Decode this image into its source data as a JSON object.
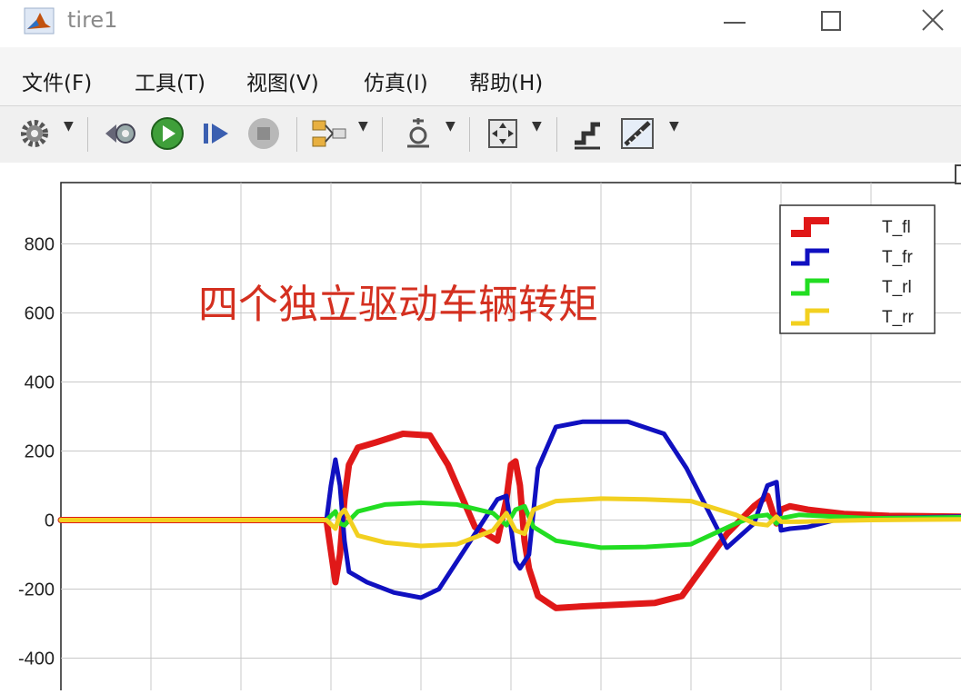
{
  "window": {
    "title": "tire1"
  },
  "menu": {
    "items": [
      "文件(F)",
      "工具(T)",
      "视图(V)",
      "仿真(I)",
      "帮助(H)"
    ]
  },
  "toolbar": {
    "icons": [
      "gear-icon",
      "signal-tap-icon",
      "run-icon",
      "step-forward-icon",
      "stop-icon",
      "signal-select-icon",
      "zoom-icon",
      "fit-view-icon",
      "style-icon",
      "ruler-icon"
    ]
  },
  "chart_data": {
    "type": "line",
    "title": "四个独立驱动车辆转矩",
    "xlabel": "",
    "ylabel": "",
    "xlim": [
      0,
      10
    ],
    "ylim": [
      -480,
      970
    ],
    "yticks": [
      -400,
      -200,
      0,
      200,
      400,
      600,
      800
    ],
    "grid": true,
    "legend_position": "top-right",
    "series": [
      {
        "name": "T_fl",
        "color": "#e01818",
        "x": [
          0,
          2.95,
          3.0,
          3.05,
          3.1,
          3.15,
          3.2,
          3.3,
          3.5,
          3.8,
          4.1,
          4.3,
          4.6,
          4.85,
          4.95,
          5.0,
          5.05,
          5.1,
          5.15,
          5.2,
          5.3,
          5.5,
          5.8,
          6.2,
          6.6,
          6.9,
          7.4,
          7.7,
          7.85,
          7.95,
          8.0,
          8.1,
          8.3,
          8.7,
          9.2,
          10
        ],
        "y": [
          0,
          0,
          -90,
          -180,
          -100,
          60,
          160,
          210,
          225,
          250,
          245,
          160,
          -20,
          -60,
          60,
          160,
          170,
          100,
          -60,
          -140,
          -220,
          -255,
          -250,
          -245,
          -240,
          -220,
          -40,
          40,
          70,
          -10,
          30,
          40,
          30,
          18,
          12,
          10
        ]
      },
      {
        "name": "T_fr",
        "color": "#1010c0",
        "x": [
          0,
          2.95,
          3.0,
          3.05,
          3.1,
          3.15,
          3.2,
          3.4,
          3.7,
          4.0,
          4.2,
          4.6,
          4.85,
          4.95,
          5.0,
          5.05,
          5.1,
          5.2,
          5.3,
          5.5,
          5.8,
          6.3,
          6.7,
          6.95,
          7.4,
          7.7,
          7.85,
          7.95,
          8.0,
          8.1,
          8.3,
          8.6,
          9.0,
          10
        ],
        "y": [
          0,
          0,
          100,
          175,
          100,
          -60,
          -150,
          -180,
          -210,
          -225,
          -200,
          -40,
          60,
          70,
          -20,
          -120,
          -140,
          -100,
          150,
          270,
          285,
          285,
          250,
          150,
          -80,
          -10,
          100,
          110,
          -30,
          -25,
          -20,
          0,
          5,
          10
        ]
      },
      {
        "name": "T_rl",
        "color": "#22dd22",
        "x": [
          0,
          2.95,
          3.05,
          3.1,
          3.15,
          3.3,
          3.6,
          4.0,
          4.4,
          4.8,
          4.95,
          5.05,
          5.15,
          5.25,
          5.5,
          6.0,
          6.5,
          7.0,
          7.5,
          7.7,
          7.85,
          7.95,
          8.0,
          8.2,
          8.6,
          9.0,
          10
        ],
        "y": [
          0,
          0,
          25,
          -10,
          -15,
          25,
          45,
          50,
          45,
          20,
          -15,
          30,
          40,
          -20,
          -60,
          -80,
          -78,
          -70,
          -10,
          10,
          15,
          -10,
          5,
          15,
          10,
          5,
          8
        ]
      },
      {
        "name": "T_rr",
        "color": "#f2d020",
        "x": [
          0,
          2.95,
          3.05,
          3.1,
          3.15,
          3.3,
          3.6,
          4.0,
          4.4,
          4.8,
          4.95,
          5.05,
          5.15,
          5.25,
          5.5,
          6.0,
          6.5,
          7.0,
          7.5,
          7.7,
          7.85,
          7.95,
          8.0,
          8.2,
          8.6,
          9.0,
          10
        ],
        "y": [
          0,
          0,
          -25,
          15,
          30,
          -45,
          -65,
          -75,
          -70,
          -30,
          20,
          -30,
          -40,
          30,
          55,
          62,
          60,
          55,
          15,
          -10,
          -15,
          10,
          -5,
          -5,
          -2,
          0,
          2
        ]
      }
    ]
  }
}
